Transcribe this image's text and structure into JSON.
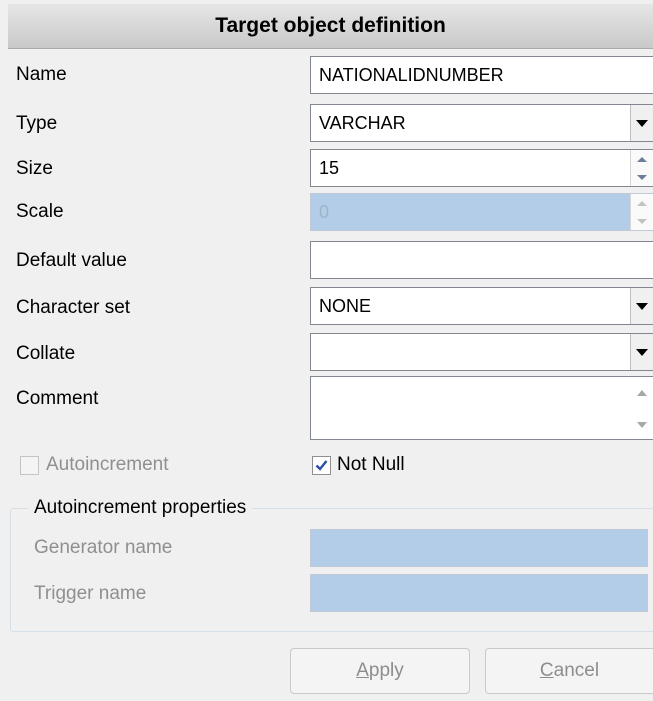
{
  "header": {
    "title": "Target object definition"
  },
  "fields": {
    "name": {
      "label": "Name",
      "value": "NATIONALIDNUMBER"
    },
    "type": {
      "label": "Type",
      "value": "VARCHAR"
    },
    "size": {
      "label": "Size",
      "value": "15"
    },
    "scale": {
      "label": "Scale",
      "value": "0"
    },
    "default_value": {
      "label": "Default value",
      "value": ""
    },
    "character_set": {
      "label": "Character set",
      "value": "NONE"
    },
    "collate": {
      "label": "Collate",
      "value": ""
    },
    "comment": {
      "label": "Comment",
      "value": ""
    }
  },
  "checkboxes": {
    "autoincrement": {
      "label": "Autoincrement",
      "checked": false,
      "enabled": false
    },
    "not_null": {
      "label": "Not Null",
      "checked": true,
      "enabled": true
    }
  },
  "autoinc_group": {
    "legend": "Autoincrement properties",
    "generator_name": {
      "label": "Generator name",
      "value": ""
    },
    "trigger_name": {
      "label": "Trigger name",
      "value": ""
    }
  },
  "buttons": {
    "apply": {
      "first": "A",
      "rest": "pply"
    },
    "cancel": {
      "first": "C",
      "rest": "ancel"
    }
  },
  "colors": {
    "disabled_field_bg": "#b3cde8",
    "check_mark": "#2a4fa8"
  }
}
